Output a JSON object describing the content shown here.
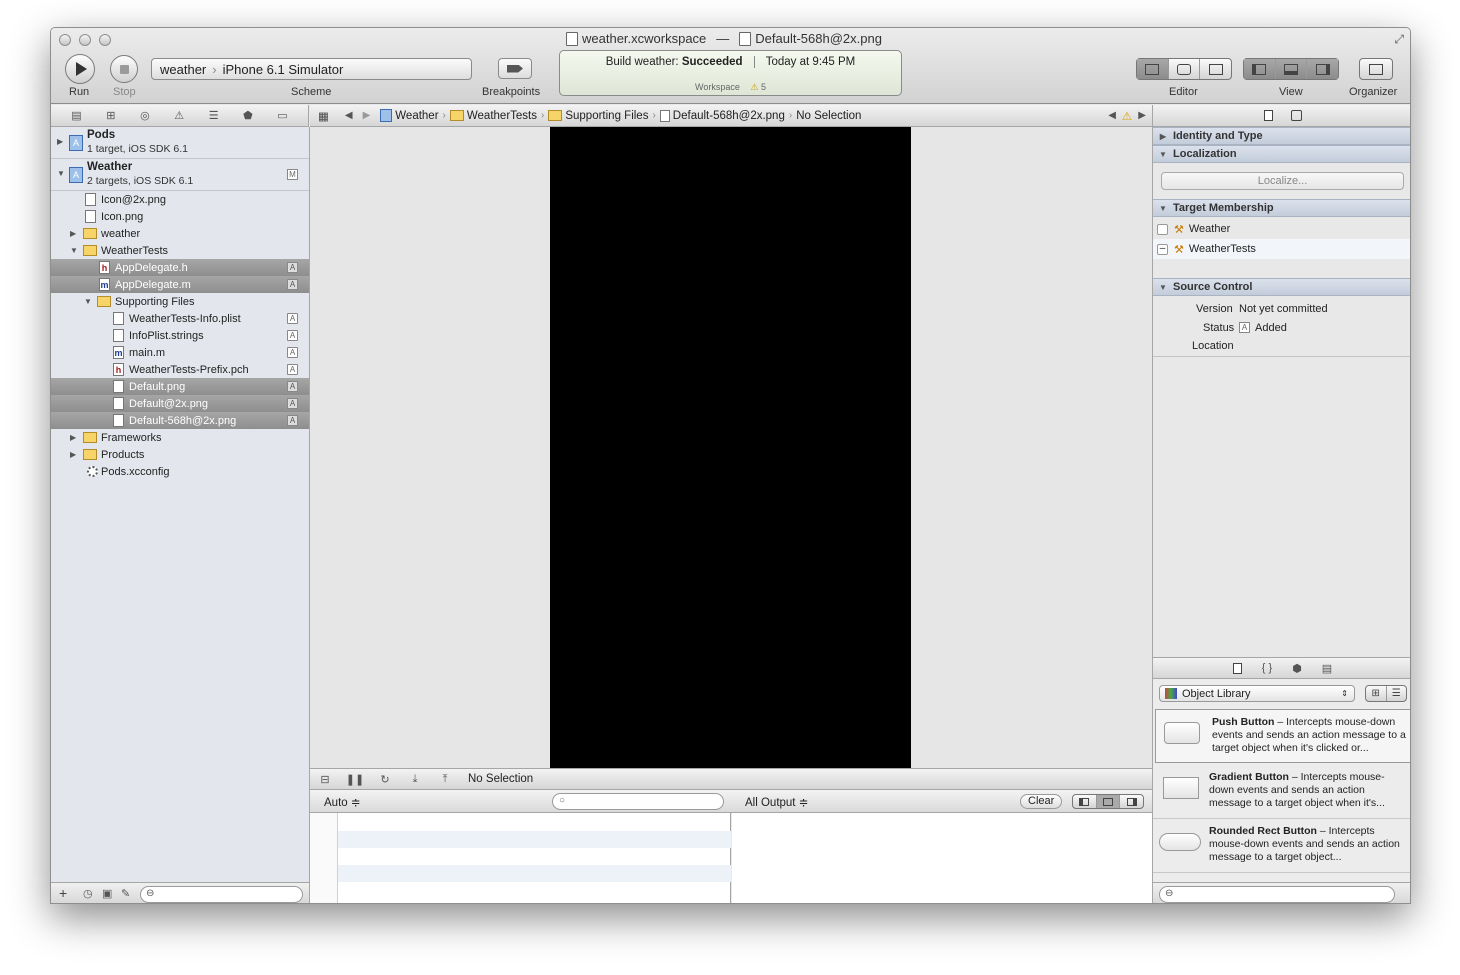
{
  "window": {
    "title_workspace": "weather.xcworkspace",
    "title_sep": "—",
    "title_file": "Default-568h@2x.png"
  },
  "toolbar": {
    "run_label": "Run",
    "stop_label": "Stop",
    "scheme_target": "weather",
    "scheme_sep": "›",
    "scheme_device": "iPhone 6.1 Simulator",
    "scheme_label": "Scheme",
    "breakpoints_label": "Breakpoints",
    "editor_label": "Editor",
    "view_label": "View",
    "organizer_label": "Organizer"
  },
  "activity": {
    "build_prefix": "Build weather:",
    "build_status": "Succeeded",
    "build_time": "Today at 9:45 PM",
    "workspace_label": "Workspace",
    "warning_icon": "⚠",
    "warning_count": "5"
  },
  "navigator": {
    "projects": [
      {
        "name": "Pods",
        "subtitle": "1 target, iOS SDK 6.1"
      },
      {
        "name": "Weather",
        "subtitle": "2 targets, iOS SDK 6.1",
        "badge": "M"
      }
    ],
    "rows": [
      {
        "label": "Icon@2x.png",
        "badge": ""
      },
      {
        "label": "Icon.png",
        "badge": ""
      },
      {
        "label": "weather",
        "badge": ""
      },
      {
        "label": "WeatherTests",
        "badge": ""
      },
      {
        "label": "AppDelegate.h",
        "badge": "A"
      },
      {
        "label": "AppDelegate.m",
        "badge": "A"
      },
      {
        "label": "Supporting Files",
        "badge": ""
      },
      {
        "label": "WeatherTests-Info.plist",
        "badge": "A"
      },
      {
        "label": "InfoPlist.strings",
        "badge": "A"
      },
      {
        "label": "main.m",
        "badge": "A"
      },
      {
        "label": "WeatherTests-Prefix.pch",
        "badge": "A"
      },
      {
        "label": "Default.png",
        "badge": "A"
      },
      {
        "label": "Default@2x.png",
        "badge": "A"
      },
      {
        "label": "Default-568h@2x.png",
        "badge": "A"
      },
      {
        "label": "Frameworks",
        "badge": ""
      },
      {
        "label": "Products",
        "badge": ""
      },
      {
        "label": "Pods.xcconfig",
        "badge": ""
      }
    ],
    "icon_h": "h",
    "icon_m": "m",
    "add_glyph": "+"
  },
  "jumpbar": {
    "crumbs": [
      "Weather",
      "WeatherTests",
      "Supporting Files",
      "Default-568h@2x.png"
    ],
    "selection": "No Selection"
  },
  "debug": {
    "selection": "No Selection",
    "auto_label": "Auto ≑",
    "output_label": "All Output ≑",
    "clear_label": "Clear"
  },
  "inspector": {
    "identity_header": "Identity and Type",
    "localization_header": "Localization",
    "localize_button": "Localize...",
    "membership_header": "Target Membership",
    "targets": [
      "Weather",
      "WeatherTests"
    ],
    "source_header": "Source Control",
    "version_label": "Version",
    "version_value": "Not yet committed",
    "status_label": "Status",
    "status_badge": "A",
    "status_value": "Added",
    "location_label": "Location"
  },
  "library": {
    "selector": "Object Library",
    "items": [
      {
        "name": "Push Button",
        "desc": " – Intercepts mouse-down events and sends an action message to a target object when it's clicked or..."
      },
      {
        "name": "Gradient Button",
        "desc": " – Intercepts mouse-down events and sends an action message to a target object when it's..."
      },
      {
        "name": "Rounded Rect Button",
        "desc": " – Intercepts mouse-down events and sends an action message to a target object..."
      }
    ]
  }
}
